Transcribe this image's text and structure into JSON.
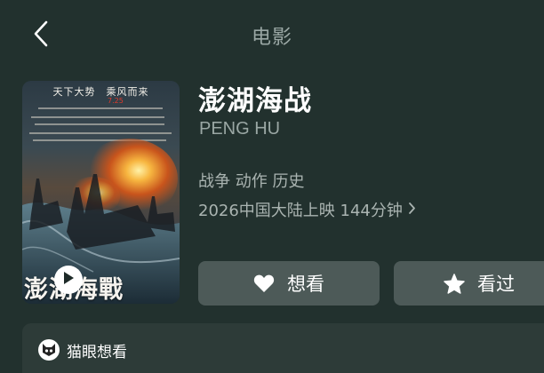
{
  "header": {
    "title": "电影",
    "back_icon": "chevron-left-icon"
  },
  "poster": {
    "tagline": "天下大势　乘风而来",
    "title_text": "澎湖海戰",
    "play_icon": "play-icon"
  },
  "movie": {
    "title_cn": "澎湖海战",
    "title_en": "PENG HU",
    "genres": "战争 动作 历史",
    "release": "2026中国大陆上映 144分钟"
  },
  "actions": {
    "want_label": "想看",
    "want_icon": "heart-icon",
    "seen_label": "看过",
    "seen_icon": "star-icon"
  },
  "bottom_card": {
    "label": "猫眼想看",
    "icon": "maoyan-cat-icon"
  },
  "colors": {
    "background": "#22312e",
    "button": "#4d5a58",
    "muted_text": "#9aa7a4"
  }
}
